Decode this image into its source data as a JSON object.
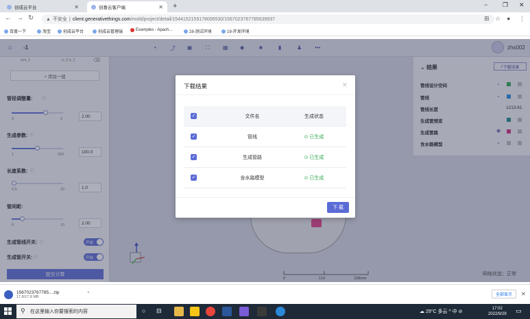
{
  "browser": {
    "tabs": [
      {
        "title": "创成云平台",
        "active": false
      },
      {
        "title": "创喜云客户端",
        "active": true
      }
    ],
    "address": {
      "security_label": "不安全",
      "host": "client.generativethings.com",
      "path": "/mold/project/detail/1544152159178006530/1567023767785639937"
    },
    "bookmarks": [
      "百度一下",
      "淘宝",
      "创成云平台",
      "创成云管理端",
      "Examples - Apach...",
      "28-测试环境",
      "19-开发环境"
    ]
  },
  "app": {
    "page_number": "-1",
    "user": "zhs002",
    "left_panel": {
      "group_fields": [
        "zys_1",
        "e_2,e_1"
      ],
      "add_group": "+ 添加一组",
      "params": [
        {
          "label": "管径调整量:",
          "min": "0",
          "max": "3",
          "value": "2.00",
          "fraction": 0.67
        },
        {
          "label": "生成参数:",
          "min": "1",
          "max": "200",
          "value": "100.0",
          "fraction": 0.5
        },
        {
          "label": "长度系数:",
          "min": "0.5",
          "max": "20",
          "value": "1.0",
          "fraction": 0.03
        },
        {
          "label": "管间距:",
          "min": "0",
          "max": "10",
          "value": "2.00",
          "fraction": 0.2
        }
      ],
      "toggles": [
        {
          "label": "生成管线开关:",
          "state": "开启"
        },
        {
          "label": "生成管开关:",
          "state": "开启"
        }
      ],
      "submit": "提交计算"
    },
    "result_panel": {
      "title": "结果",
      "download_button": "下载结果",
      "rows": [
        {
          "label": "管线设计空间",
          "color": "#2aa84f"
        },
        {
          "label": "管线",
          "color": "#1e88e5"
        },
        {
          "label": "管线长度",
          "value": "1213.61"
        },
        {
          "label": "生成管预览",
          "color": "#1a8a8a"
        },
        {
          "label": "生成管路",
          "color": "#d0287a"
        },
        {
          "label": "含水路模型",
          "color": "#bbbbbb"
        }
      ]
    },
    "scale": {
      "ticks": [
        "0",
        "119",
        "238mm"
      ]
    },
    "network_status": "网络状态：正常"
  },
  "modal": {
    "title": "下载结果",
    "columns": [
      "文件名",
      "生成状态"
    ],
    "rows": [
      {
        "name": "管线",
        "status": "已生成"
      },
      {
        "name": "生成管路",
        "status": "已生成"
      },
      {
        "name": "含水路模型",
        "status": "已生成"
      }
    ],
    "download_button": "下 载"
  },
  "downloads": {
    "file_name": "1567023767785....zip",
    "file_size": "17.8/17.8 MB",
    "show_all": "全部显示"
  },
  "taskbar": {
    "search_placeholder": "在这里输入你要搜索的内容",
    "weather": "29°C 多云",
    "ime": "中",
    "time": "17:02",
    "date": "2022/9/29"
  }
}
